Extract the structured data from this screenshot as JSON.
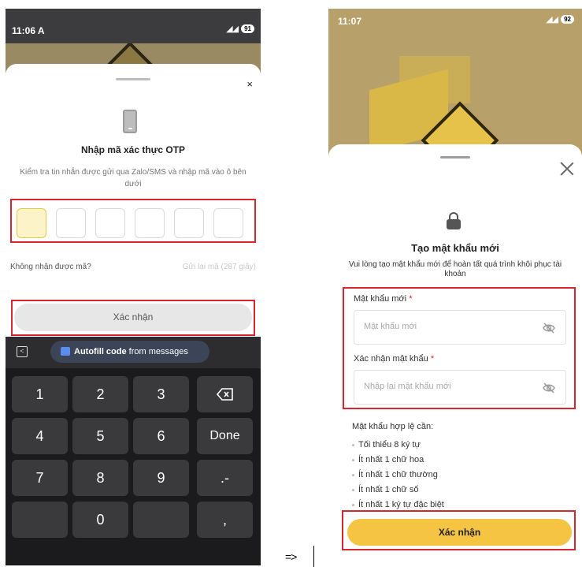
{
  "left": {
    "status": {
      "time": "11:06 A",
      "battery": "91"
    },
    "otp_title": "Nhập mã xác thực OTP",
    "otp_desc": "Kiểm tra tin nhắn được gửi qua Zalo/SMS và nhập mã vào ô bên dưới",
    "no_code": "Không nhận được mã?",
    "resend": "Gửi lại mã (287 giây)",
    "confirm": "Xác nhận",
    "close": "×",
    "autofill_a": "Autofill code",
    "autofill_b": " from messages",
    "keys": [
      "1",
      "2",
      "3",
      "4",
      "5",
      "6",
      "Done",
      "7",
      "8",
      "9",
      ".-",
      "0",
      ","
    ]
  },
  "arrow": "=>",
  "right": {
    "status": {
      "time": "11:07",
      "battery": "92"
    },
    "title": "Tạo mật khẩu mới",
    "desc": "Vui lòng tạo mật khẩu mới để hoàn tất quá trình khôi phục tài khoản",
    "new_pw_label": "Mật khẩu mới",
    "new_pw_placeholder": "Mật khẩu mới",
    "confirm_pw_label": "Xác nhận mật khẩu",
    "confirm_pw_placeholder": "Nhập lại mật khẩu mới",
    "required_mark": "*",
    "req_title": "Mật khẩu hợp lệ cần:",
    "req_items": [
      "Tối thiểu 8 ký tự",
      "Ít nhất 1 chữ hoa",
      "Ít nhất 1 chữ thường",
      "Ít nhất 1 chữ số",
      "Ít nhất 1 ký tự đặc biệt"
    ],
    "confirm": "Xác nhận"
  },
  "colors": {
    "accent": "#f5c443",
    "highlight": "#d6262f",
    "otp_active": "#fdf3c9"
  }
}
